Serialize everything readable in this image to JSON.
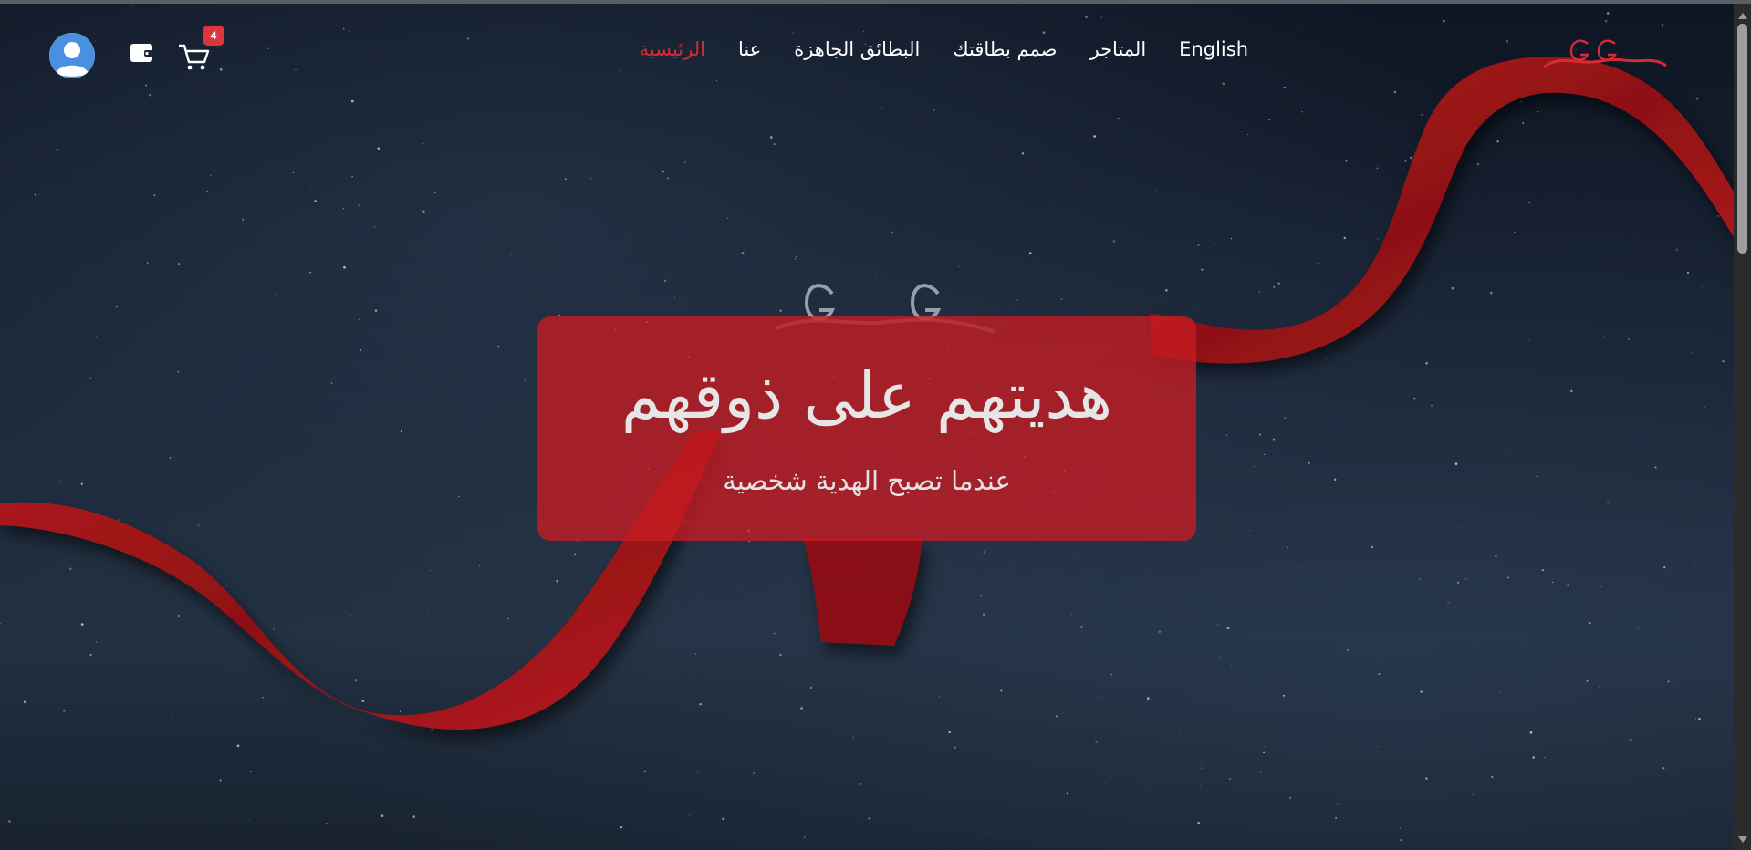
{
  "nav": {
    "links": [
      {
        "label": "الرئيسية",
        "active": true
      },
      {
        "label": "عنا",
        "active": false
      },
      {
        "label": "البطائق الجاهزة",
        "active": false
      },
      {
        "label": "صمم بطاقتك",
        "active": false
      },
      {
        "label": "المتاجر",
        "active": false
      },
      {
        "label": "English",
        "active": false
      }
    ],
    "cart_count": "4",
    "icons": [
      "user-avatar-icon",
      "wallet-icon",
      "cart-icon",
      "gg-logo-icon"
    ]
  },
  "hero": {
    "headline": "هديتهم على ذوقهم",
    "subline": "عندما تصبح الهدية شخصية"
  },
  "colors": {
    "accent": "#d52b33",
    "card": "#c81c22",
    "background": "#1a2536",
    "ribbon": "#9e1419"
  }
}
